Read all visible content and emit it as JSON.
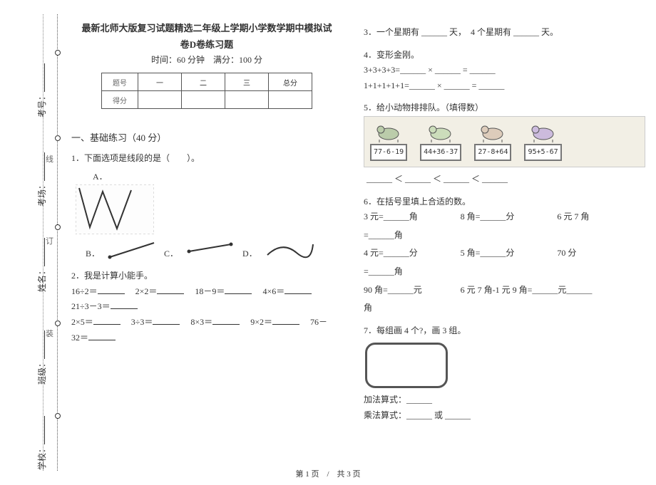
{
  "binding": {
    "school": "学校：",
    "class_": "班级：",
    "name": "姓名：",
    "room": "考场：",
    "id": "考号：",
    "fold1": "装",
    "fold2": "订",
    "fold3": "线"
  },
  "header": {
    "title1": "最新北师大版复习试题精选二年级上学期小学数学期中模拟试",
    "title2": "卷D卷练习题",
    "meta": "时间：60 分钟　满分：100 分"
  },
  "score": {
    "h0": "题号",
    "h1": "一",
    "h2": "二",
    "h3": "三",
    "h4": "总分",
    "r0": "得分"
  },
  "sections": {
    "s1": "一、基础练习（40 分）"
  },
  "q1": {
    "stem": "1．下面选项是线段的是（　　）。",
    "optA": "A．",
    "optB": "B．",
    "optC": "C．",
    "optD": "D．"
  },
  "q2": {
    "stem": "2．我是计算小能手。",
    "e1a": "16÷2＝",
    "e1b": "2×2＝",
    "e1c": "18－9＝",
    "e1d": "4×6＝",
    "e2a": "21÷3－3＝",
    "e3a": "2×5＝",
    "e3b": "3÷3＝",
    "e3c": "8×3＝",
    "e3d": "9×2＝",
    "e3e": "76－",
    "e4a": "32＝"
  },
  "q3": {
    "text": "3．一个星期有 ______ 天，　4 个星期有 ______ 天。"
  },
  "q4": {
    "stem": "4．变形金刚。",
    "line1": "3+3+3+3=______ × ______ = ______",
    "line2": "1+1+1+1+1=______ × ______ = ______"
  },
  "q5": {
    "stem": "5．给小动物排排队。（填得数）",
    "animals": [
      {
        "expr": "77-6-19"
      },
      {
        "expr": "44+36-37"
      },
      {
        "expr": "27-8+64"
      },
      {
        "expr": "95+5-67"
      }
    ],
    "ineq": "______ ＜ ______ ＜ ______ ＜ ______"
  },
  "q6": {
    "stem": "6．在括号里填上合适的数。",
    "cells": [
      "3 元=______角",
      "8 角=______分",
      "6 元 7 角",
      "=______角",
      "4 元=______分",
      "5 角=______分",
      "70 分",
      "=______角",
      "90 角=______元",
      "6 元 7 角-1 元 9 角=______元______",
      "",
      "角"
    ]
  },
  "q7": {
    "stem": "7．每组画 4 个?，画 3 组。",
    "add": "加法算式：______",
    "mul": "乘法算式：______ 或 ______"
  },
  "footer": "第 1 页　/　共 3 页"
}
